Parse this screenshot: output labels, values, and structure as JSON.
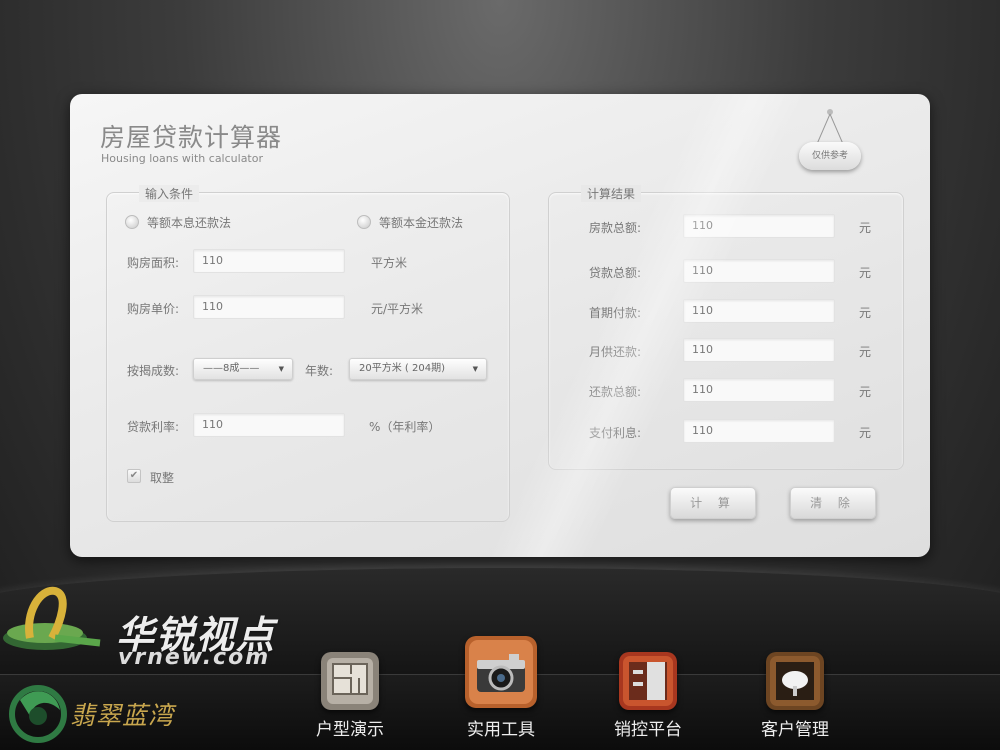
{
  "app": {
    "title": "房屋贷款计算器",
    "subtitle": "Housing loans with calculator",
    "tag": "仅供参考"
  },
  "input_section": {
    "legend": "输入条件",
    "radio_equal_interest": "等额本息还款法",
    "radio_equal_principal": "等额本金还款法",
    "area_label": "购房面积:",
    "area_value": "110",
    "area_unit": "平方米",
    "price_label": "购房单价:",
    "price_value": "110",
    "price_unit": "元/平方米",
    "ratio_label": "按揭成数:",
    "ratio_selected": "——8成——",
    "years_label": "年数:",
    "years_selected": "20平方米 ( 204期)",
    "rate_label": "贷款利率:",
    "rate_value": "110",
    "rate_unit": "%（年利率）",
    "round_label": "取整",
    "round_checked": true
  },
  "result_section": {
    "legend": "计算结果",
    "rows": [
      {
        "label": "房款总额:",
        "value": "110",
        "unit": "元"
      },
      {
        "label": "贷款总额:",
        "value": "110",
        "unit": "元"
      },
      {
        "label": "首期付款:",
        "value": "110",
        "unit": "元"
      },
      {
        "label": "月供还款:",
        "value": "110",
        "unit": "元"
      },
      {
        "label": "还款总额:",
        "value": "110",
        "unit": "元"
      },
      {
        "label": "支付利息:",
        "value": "110",
        "unit": "元"
      }
    ]
  },
  "buttons": {
    "calculate": "计 算",
    "clear": "清 除"
  },
  "branding": {
    "watermark": "华锐视点",
    "watermark_url": "vrnew.com",
    "project_name": "翡翠蓝湾"
  },
  "nav": {
    "items": [
      {
        "label": "户型演示",
        "icon": "floorplan-icon"
      },
      {
        "label": "实用工具",
        "icon": "camera-icon"
      },
      {
        "label": "销控平台",
        "icon": "cabinet-icon"
      },
      {
        "label": "客户管理",
        "icon": "lamp-icon"
      }
    ]
  },
  "colors": {
    "panel": "#ececec",
    "text_muted": "#777777",
    "brand_gold": "#c9a74e",
    "icon_orange": "#c8703a"
  }
}
